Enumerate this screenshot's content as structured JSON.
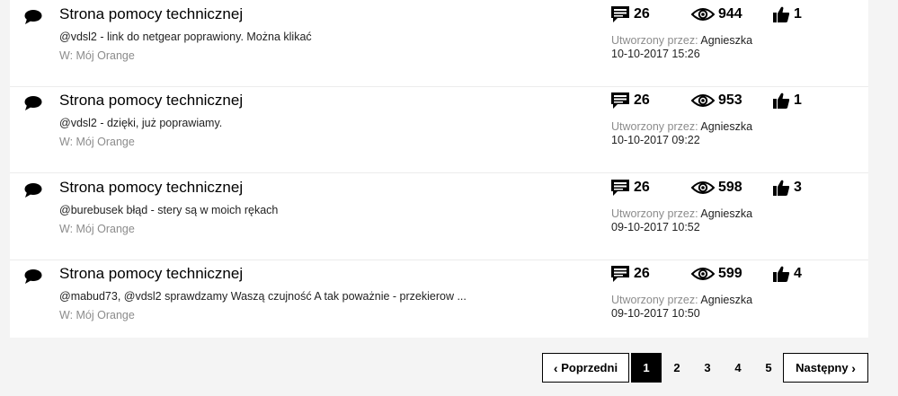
{
  "posts": [
    {
      "title": "Strona pomocy technicznej",
      "excerpt": "@vdsl2 - link do netgear poprawiony. Można klikać",
      "board": "W: Mój Orange",
      "replies": "26",
      "views": "944",
      "kudos": "1",
      "author_label": "Utworzony przez:",
      "author": "Agnieszka",
      "date": "10-10-2017 15:26"
    },
    {
      "title": "Strona pomocy technicznej",
      "excerpt": "@vdsl2 - dzięki, już poprawiamy.",
      "board": "W: Mój Orange",
      "replies": "26",
      "views": "953",
      "kudos": "1",
      "author_label": "Utworzony przez:",
      "author": "Agnieszka",
      "date": "10-10-2017 09:22"
    },
    {
      "title": "Strona pomocy technicznej",
      "excerpt": "@burebusek błąd - stery są w moich rękach",
      "board": "W: Mój Orange",
      "replies": "26",
      "views": "598",
      "kudos": "3",
      "author_label": "Utworzony przez:",
      "author": "Agnieszka",
      "date": "09-10-2017 10:52"
    },
    {
      "title": "Strona pomocy technicznej",
      "excerpt": "@mabud73, @vdsl2 sprawdzamy Waszą czujność A tak poważnie - przekierow ...",
      "board": "W: Mój Orange",
      "replies": "26",
      "views": "599",
      "kudos": "4",
      "author_label": "Utworzony przez:",
      "author": "Agnieszka",
      "date": "09-10-2017 10:50"
    }
  ],
  "pagination": {
    "prev_label": "Poprzedni",
    "next_label": "Następny",
    "pages": [
      "1",
      "2",
      "3",
      "4",
      "5"
    ],
    "current_page": "1"
  },
  "icons": {
    "post": "speech-bubble-icon",
    "replies": "comment-icon",
    "views": "eye-icon",
    "kudos": "thumbs-up-icon",
    "prev": "chevron-left-icon",
    "next": "chevron-right-icon"
  },
  "colors": {
    "background": "#f4f4f4",
    "card": "#ffffff",
    "muted": "#8c8c8c",
    "active_page": "#000000"
  }
}
